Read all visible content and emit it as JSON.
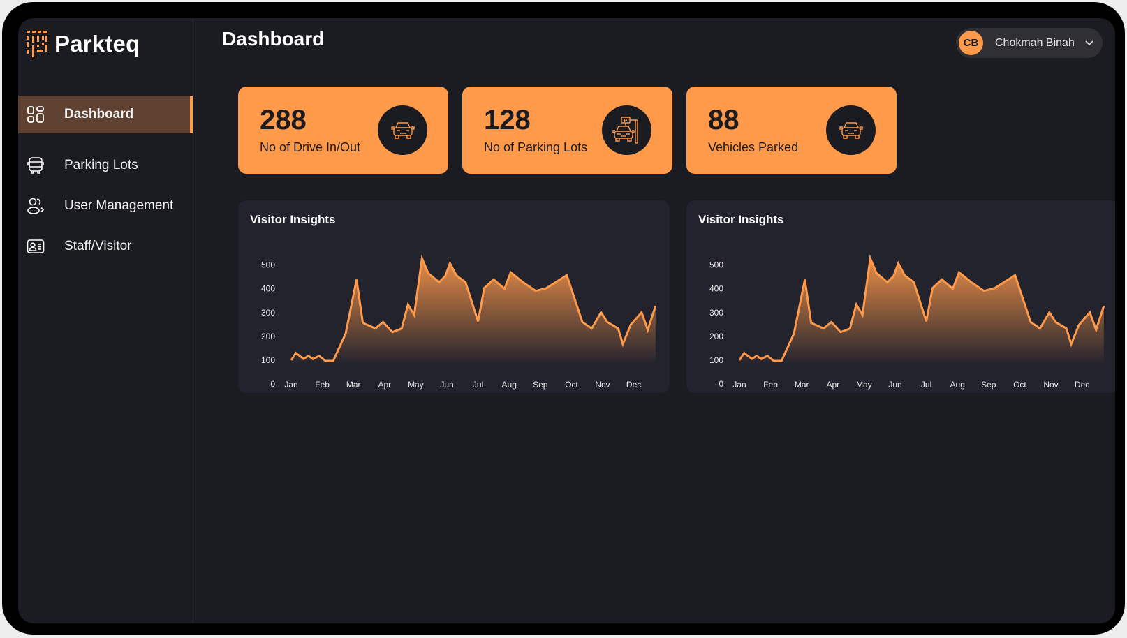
{
  "app": {
    "name": "Parkteq"
  },
  "sidebar": {
    "items": [
      {
        "label": "Dashboard",
        "icon": "dashboard-grid-icon",
        "active": true
      },
      {
        "label": "Parking Lots",
        "icon": "bus-icon",
        "active": false
      },
      {
        "label": "User Management",
        "icon": "users-icon",
        "active": false
      },
      {
        "label": "Staff/Visitor",
        "icon": "id-card-icon",
        "active": false
      }
    ]
  },
  "header": {
    "title": "Dashboard",
    "user": {
      "initials": "CB",
      "name": "Chokmah Binah",
      "menu_icon": "chevron-down-icon"
    }
  },
  "stats": [
    {
      "value": "288",
      "label": "No of Drive In/Out",
      "icon": "car-icon"
    },
    {
      "value": "128",
      "label": "No of Parking Lots",
      "icon": "parking-car-icon"
    },
    {
      "value": "88",
      "label": "Vehicles Parked",
      "icon": "car-icon"
    }
  ],
  "colors": {
    "accent": "#ff9a4a",
    "background": "#1b1b22",
    "panel": "#23232e",
    "active_nav": "#5e4131"
  },
  "chart_data": [
    {
      "type": "area",
      "title": "Visitor Insights",
      "xlabel": "",
      "ylabel": "",
      "categories": [
        "Jan",
        "Feb",
        "Mar",
        "Apr",
        "May",
        "Jun",
        "Jul",
        "Aug",
        "Sep",
        "Oct",
        "Nov",
        "Dec"
      ],
      "yticks": [
        0,
        100,
        200,
        300,
        400,
        500
      ],
      "ylim": [
        0,
        540
      ],
      "grid": false,
      "x": [
        0,
        0.15,
        0.4,
        0.55,
        0.7,
        0.9,
        1.1,
        1.35,
        1.75,
        2.1,
        2.3,
        2.7,
        2.95,
        3.25,
        3.55,
        3.75,
        3.95,
        4.2,
        4.4,
        4.75,
        4.95,
        5.1,
        5.3,
        5.6,
        6.0,
        6.2,
        6.5,
        6.85,
        7.05,
        7.45,
        7.85,
        8.2,
        8.85,
        9.35,
        9.65,
        9.95,
        10.15,
        10.5,
        10.65,
        10.9,
        11.25,
        11.45,
        11.7
      ],
      "values": [
        100,
        130,
        105,
        118,
        105,
        118,
        97,
        97,
        212,
        439,
        257,
        233,
        260,
        218,
        233,
        334,
        290,
        528,
        466,
        427,
        454,
        507,
        457,
        427,
        263,
        403,
        439,
        400,
        469,
        427,
        391,
        403,
        457,
        260,
        233,
        301,
        260,
        233,
        167,
        248,
        301,
        227,
        328
      ]
    },
    {
      "type": "area",
      "title": "Visitor Insights",
      "xlabel": "",
      "ylabel": "",
      "categories": [
        "Jan",
        "Feb",
        "Mar",
        "Apr",
        "May",
        "Jun",
        "Jul",
        "Aug",
        "Sep",
        "Oct",
        "Nov",
        "Dec"
      ],
      "yticks": [
        0,
        100,
        200,
        300,
        400,
        500
      ],
      "ylim": [
        0,
        540
      ],
      "grid": false,
      "x": [
        0,
        0.15,
        0.4,
        0.55,
        0.7,
        0.9,
        1.1,
        1.35,
        1.75,
        2.1,
        2.3,
        2.7,
        2.95,
        3.25,
        3.55,
        3.75,
        3.95,
        4.2,
        4.4,
        4.75,
        4.95,
        5.1,
        5.3,
        5.6,
        6.0,
        6.2,
        6.5,
        6.85,
        7.05,
        7.45,
        7.85,
        8.2,
        8.85,
        9.35,
        9.65,
        9.95,
        10.15,
        10.5,
        10.65,
        10.9,
        11.25,
        11.45,
        11.7
      ],
      "values": [
        100,
        130,
        105,
        118,
        105,
        118,
        97,
        97,
        212,
        439,
        257,
        233,
        260,
        218,
        233,
        334,
        290,
        528,
        466,
        427,
        454,
        507,
        457,
        427,
        263,
        403,
        439,
        400,
        469,
        427,
        391,
        403,
        457,
        260,
        233,
        301,
        260,
        233,
        167,
        248,
        301,
        227,
        328
      ]
    }
  ]
}
